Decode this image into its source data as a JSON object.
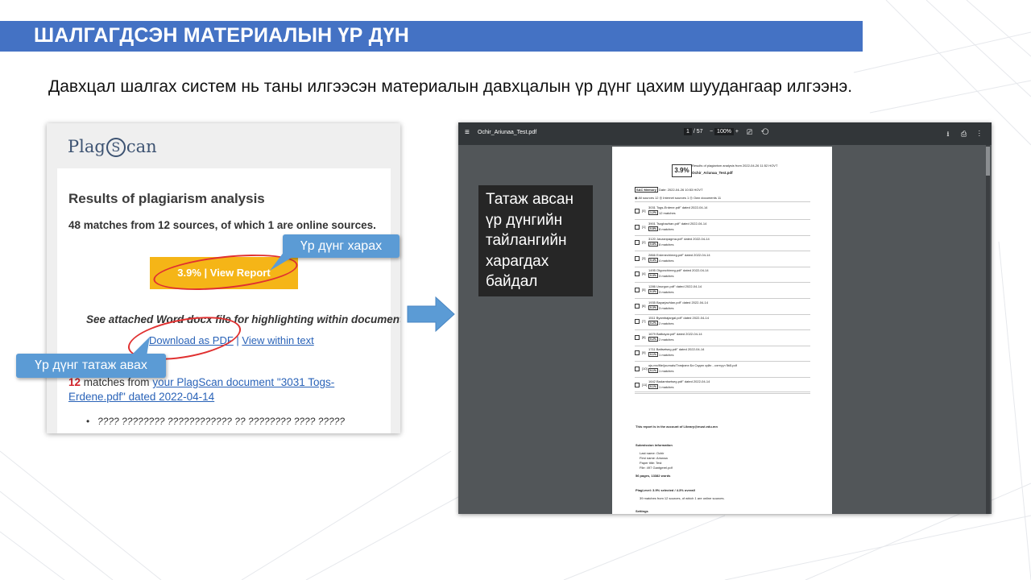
{
  "header": {
    "title": "ШАЛГАГДСЭН МАТЕРИАЛЫН ҮР ДҮН",
    "subtitle": "Давхцал шалгах систем нь таны илгээсэн материалын давхцалын үр дүнг цахим шуудангаар илгээнэ."
  },
  "email": {
    "logo_before": "Plag",
    "logo_s": "S",
    "logo_after": "can",
    "heading": "Results of plagiarism analysis",
    "summary": "48 matches from 12 sources, of which 1 are online sources.",
    "report_button": "3.9% | View Report",
    "attached_note": "See attached Word docx file for highlighting within document!",
    "download_link": "Download as PDF",
    "link_separator": " | ",
    "view_link": "View within text",
    "matches_count": "12",
    "matches_text": " matches from ",
    "matches_link": "your PlagScan document \"3031 Togs-Erdene.pdf\" dated 2022-04-14",
    "bullet_text": "???? ???????? ???????????? ?? ???????? ???? ?????"
  },
  "callouts": {
    "view_result": "Үр дүнг харах",
    "download_result": "Үр дүнг татаж авах"
  },
  "viewer_note": {
    "lines": [
      "Татаж авсан",
      "үр дүнгийн",
      "тайлангийн",
      "харагдах",
      "байдал"
    ]
  },
  "pdf_viewer": {
    "menu_icon": "≡",
    "file_name": "Ochir_Ariunaa_Test.pdf",
    "page_current": "1",
    "page_total": "/ 57",
    "zoom_minus": "−",
    "zoom_value": "100%",
    "zoom_plus": "+",
    "toolbar_icons": "⎚ ⟲",
    "right_icons": "⭳ ⎙ ⋮",
    "page": {
      "score": "3.9%",
      "results_line": "Results of plagiarism analysis from 2022-04-26 11:52 HOVT",
      "doc_name": "Ochir_Ariunaa_Test.pdf",
      "tag": "SAC Memory",
      "date": "Date: 2022-04-26 10:53 HOVT",
      "sources_row": "◉ All sources  12    ◎ Internet sources  1    ◎ Own documents  11",
      "sources": [
        {
          "num": "[0]",
          "name": "3031 Togs-Erdene.pdf\" dated 2022-04-14",
          "pct": "1.2%",
          "cnt": "12 matches"
        },
        {
          "num": "[1]",
          "name": "3901 Tsogbazhan.pdf\" dated 2022-04-14",
          "pct": "0.8%",
          "cnt": "8 matches"
        },
        {
          "num": "[2]",
          "name": "3120 Javzanpagma.pdf\" dated 2022-04-14",
          "pct": "0.8%",
          "cnt": "8 matches"
        },
        {
          "num": "[3]",
          "name": "2866 Erdenechimeg.pdf\" dated 2022-04-14",
          "pct": "0.4%",
          "cnt": "4 matches"
        },
        {
          "num": "[4]",
          "name": "1495 Otgonchimeg.pdf\" dated 2022-04-14",
          "pct": "0.3%",
          "cnt": "3 matches"
        },
        {
          "num": "[5]",
          "name": "1286 Unurgun.pdf\" dated 2022-04-14",
          "pct": "0.3%",
          "cnt": "3 matches"
        },
        {
          "num": "[6]",
          "name": "1935 Bayarjavhlan.pdf\" dated 2022-04-14",
          "pct": "0.3%",
          "cnt": "3 matches"
        },
        {
          "num": "[7]",
          "name": "1511 Byambajargal.pdf\" dated 2022-04-14",
          "pct": "0.2%",
          "cnt": "2 matches"
        },
        {
          "num": "[8]",
          "name": "1679 Batbayar.pdf\" dated 2022-04-14",
          "pct": "0.2%",
          "cnt": "2 matches"
        },
        {
          "num": "[9]",
          "name": "1711 Battsetseg.pdf\" dated 2022-04-14",
          "pct": "0.1%",
          "cnt": "1 matches"
        },
        {
          "num": "[10]",
          "name": "ojs.mn/file/journals/Тэнфэнэ Бэ Сэдэн зүйл - сэтгүүл №5.pdf",
          "pct": "0.1%",
          "cnt": "1 matches"
        },
        {
          "num": "[11]",
          "name": "1642 Badamtsetseg.pdf\" dated 2022-04-14",
          "pct": "0.1%",
          "cnt": "1 matches"
        }
      ],
      "account": "This report is in the account of Library@must.edu.mn",
      "submission_heading": "Submission information",
      "submission_lines": [
        "Last name: Ochir",
        "First name: Ariunaa",
        "Paper title: Test",
        "File: 497 Gantgerel.pdf"
      ],
      "pages_words": "56 pages, 13382 words",
      "plag_level": "PlagLevel: 3.9% selected / 4.3% overall",
      "plag_detail": "39 matches from 12 sources, of which 1 are online sources.",
      "settings": "Settings"
    }
  },
  "colors": {
    "title_bar": "#4472c4",
    "callout": "#5b9bd5",
    "report_button": "#f5b517",
    "highlight_ellipse": "#e03030",
    "viewer_bg": "#525659"
  }
}
